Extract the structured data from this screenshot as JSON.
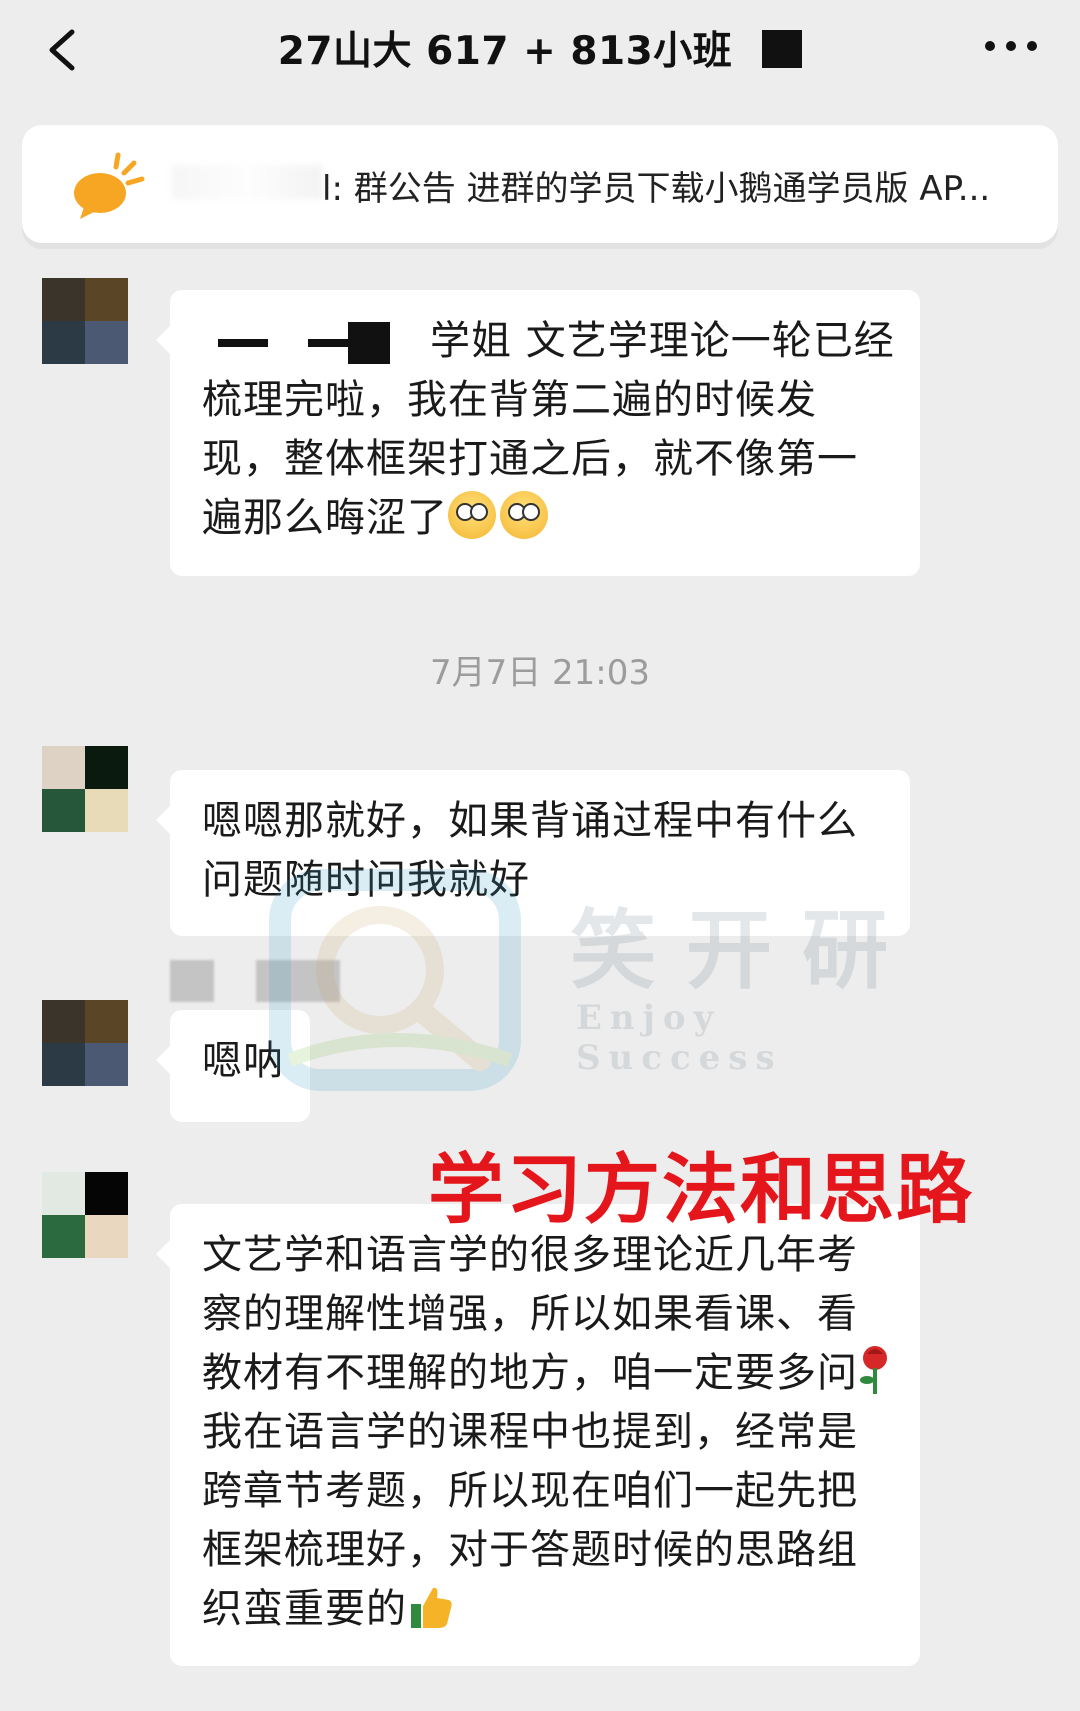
{
  "header": {
    "title": "27山大 617 + 813小班"
  },
  "notice": {
    "text": "l: 群公告 进群的学员下载小鹅通学员版 AP..."
  },
  "messages": [
    {
      "text_before": "学姐 文艺学理论一轮已经梳理完啦，我在背第二遍的时候发现，整体框架打通之后，就不像第一遍那么晦涩了"
    },
    {
      "text": "嗯嗯那就好，如果背诵过程中有什么问题随时问我就好"
    },
    {
      "text": "嗯呐"
    },
    {
      "text_part1": "文艺学和语言学的很多理论近几年考察的理解性增强，所以如果看课、看教材有不理解的地方，咱一定要多问",
      "text_part2": "我在语言学的课程中也提到，经常是跨章节考题，所以现在咱们一起先把框架梳理好，对于答题时候的思路组织蛮重要的"
    }
  ],
  "timestamp": "7月7日 21:03",
  "watermark": {
    "cn": "笑开研",
    "en": "Enjoy Success"
  },
  "overlay": "学习方法和思路",
  "icons": {
    "back": "chevron-left-icon",
    "more": "more-dots-icon",
    "notice": "announcement-icon"
  },
  "colors": {
    "background": "#ededed",
    "bubble": "#ffffff",
    "overlay": "#e4161b",
    "notice_icon": "#f6a623"
  }
}
